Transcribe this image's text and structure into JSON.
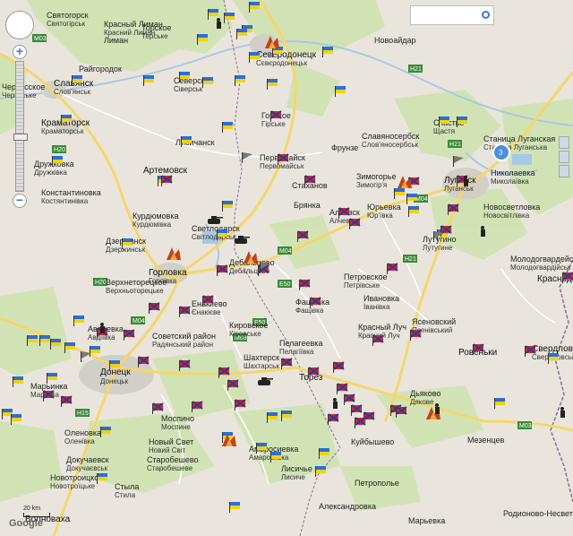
{
  "search": {
    "placeholder": ""
  },
  "zoom": {
    "plus": "+",
    "minus": "−"
  },
  "scale_label": "20 km",
  "logo_text": "Google",
  "cluster_count": "3",
  "colors": {
    "land": "#e9e5dc",
    "green": "#cfe3b1",
    "road_yellow": "#f6d66c",
    "road_white": "#ffffff",
    "border": "#8b6aa0",
    "water": "#a8c8e6",
    "urban": "#d2cfc6"
  },
  "roads": [
    "M03",
    "M04",
    "M04",
    "M03",
    "H20",
    "H21",
    "H20",
    "H21",
    "E50",
    "E50",
    "M04",
    "H21",
    "H15",
    "M03"
  ],
  "places": [
    {
      "ru": "Святогорск",
      "ua": "Святогірськ"
    },
    {
      "ru": "Красный Лиман",
      "ua": "Красний Лиман"
    },
    {
      "ru": "Северское",
      "ua": "Сіверськ"
    },
    {
      "ru": "Северодонецк",
      "ua": "Сєвєродонецьк"
    },
    {
      "ru": "Новоайдар",
      "ua": "Новоайдар"
    },
    {
      "ru": "Славянск",
      "ua": "Слов'янськ"
    },
    {
      "ru": "Краматорск",
      "ua": "Краматорськ"
    },
    {
      "ru": "Лисичанск",
      "ua": ""
    },
    {
      "ru": "Дружковка",
      "ua": "Дружківка"
    },
    {
      "ru": "Артемовск",
      "ua": ""
    },
    {
      "ru": "Первомайск",
      "ua": "Первомайськ"
    },
    {
      "ru": "Константиновка",
      "ua": "Костянтинівка"
    },
    {
      "ru": "Счастье",
      "ua": "Щастя"
    },
    {
      "ru": "Славяносербск",
      "ua": "Слов'яносербськ"
    },
    {
      "ru": "Станица Луганская",
      "ua": "Станиця Луганська"
    },
    {
      "ru": "Стаханов",
      "ua": ""
    },
    {
      "ru": "Луганск",
      "ua": "Луганськ"
    },
    {
      "ru": "Николаевка",
      "ua": "Миколаївка"
    },
    {
      "ru": "Зимогорье",
      "ua": "Зимогір'я"
    },
    {
      "ru": "Брянка",
      "ua": ""
    },
    {
      "ru": "Алчевск",
      "ua": "Алчевськ"
    },
    {
      "ru": "Юрьевка",
      "ua": "Юр'ївка"
    },
    {
      "ru": "Новосветловка",
      "ua": "Новосвітлівка"
    },
    {
      "ru": "Дзержинск",
      "ua": "Дзержинськ"
    },
    {
      "ru": "Светлодарск",
      "ua": "Світлодарськ"
    },
    {
      "ru": "Горловка",
      "ua": "Горлівка"
    },
    {
      "ru": "Дебальцево",
      "ua": "Дебальцеве"
    },
    {
      "ru": "Лутугино",
      "ua": "Лутугине"
    },
    {
      "ru": "Петровское",
      "ua": "Петрівське"
    },
    {
      "ru": "Енакиево",
      "ua": "Єнакієве"
    },
    {
      "ru": "Фащевка",
      "ua": "Фащівка"
    },
    {
      "ru": "Молодогвардейск",
      "ua": "Молодогвардійськ"
    },
    {
      "ru": "Краснодон",
      "ua": ""
    },
    {
      "ru": "Ивановка",
      "ua": "Іванівка"
    },
    {
      "ru": "Ясеновский",
      "ua": "Ясенівський"
    },
    {
      "ru": "Кировское",
      "ua": "Кіровське"
    },
    {
      "ru": "Советский район",
      "ua": "Радянський район"
    },
    {
      "ru": "Красный Луч",
      "ua": "Красний Луч"
    },
    {
      "ru": "Ровеньки",
      "ua": ""
    },
    {
      "ru": "Свердловск",
      "ua": "Свердловськ"
    },
    {
      "ru": "Авдеевка",
      "ua": "Авдіївка"
    },
    {
      "ru": "Донецк",
      "ua": "Донецьк"
    },
    {
      "ru": "Шахтерск",
      "ua": "Шахтарськ"
    },
    {
      "ru": "Пелагеевка",
      "ua": "Пелагіївка"
    },
    {
      "ru": "Торез",
      "ua": ""
    },
    {
      "ru": "Марьинка",
      "ua": "Мар'їнка"
    },
    {
      "ru": "Дьяково",
      "ua": "Дякове"
    },
    {
      "ru": "Моспино",
      "ua": "Моспине"
    },
    {
      "ru": "Оленовка",
      "ua": "Оленівка"
    },
    {
      "ru": "Новый Свет",
      "ua": "Новий Світ"
    },
    {
      "ru": "Мезенцев",
      "ua": ""
    },
    {
      "ru": "Старобешево",
      "ua": "Старобешеве"
    },
    {
      "ru": "Амвросиевка",
      "ua": "Амвросіївка"
    },
    {
      "ru": "Куйбышево",
      "ua": ""
    },
    {
      "ru": "Докучаевск",
      "ua": "Докучаєвськ"
    },
    {
      "ru": "Лисичье",
      "ua": "Лисиче"
    },
    {
      "ru": "Новотроицкое",
      "ua": "Новотроїцьке"
    },
    {
      "ru": "Петрополье",
      "ua": ""
    },
    {
      "ru": "Стыла",
      "ua": "Стила"
    },
    {
      "ru": "Александровка",
      "ua": ""
    },
    {
      "ru": "Волноваха",
      "ua": ""
    },
    {
      "ru": "Марьевка",
      "ua": ""
    },
    {
      "ru": "Родионово-Несвет",
      "ua": ""
    },
    {
      "ru": "Лисичанск",
      "ua": ""
    }
  ],
  "extra_labels": [
    "Горское",
    "Гірське",
    "Фрунзе",
    "Райгородок",
    "Торское",
    "Терське",
    "Лиман",
    "Черкасское",
    "Черкаське",
    "Семёновка",
    "Верхнеторецкое",
    "Верхньоторецьке",
    "Кирово",
    "Нью-Йорк",
    "Курдюмовка",
    "Курдюмівка",
    "Лозоватская",
    "Пески",
    "Піски",
    "Зайцево",
    "Ждановка",
    "Ровеньковский",
    "Вахрушево",
    "Краснопартизанск",
    "Лутугино",
    "Раевка",
    "Кременная"
  ]
}
